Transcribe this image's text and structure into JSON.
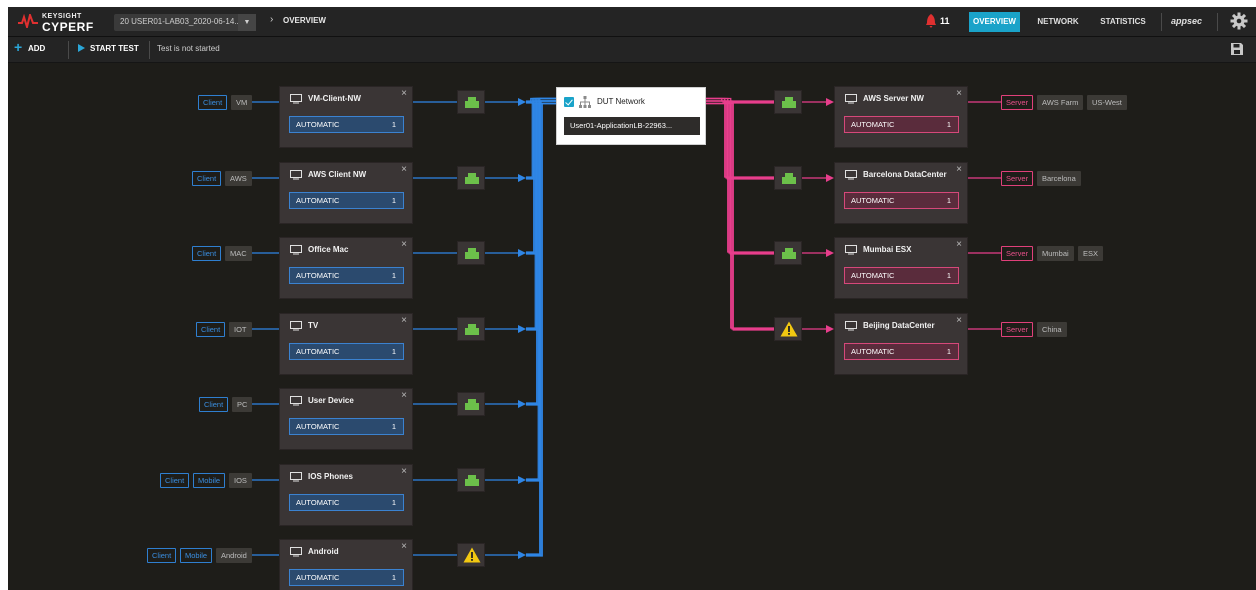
{
  "header": {
    "logo_small": "KEYSIGHT",
    "logo_big": "CYPERF",
    "config_name": "20 USER01-LAB03_2020-06-14...",
    "breadcrumb": "OVERVIEW",
    "alert_count": "11",
    "tabs": [
      {
        "label": "OVERVIEW",
        "active": true
      },
      {
        "label": "NETWORK",
        "active": false
      },
      {
        "label": "STATISTICS",
        "active": false
      }
    ],
    "user": "appsec"
  },
  "toolbar": {
    "add_label": "ADD",
    "start_label": "START TEST",
    "status": "Test is not started"
  },
  "client_networks": [
    {
      "tags": [
        {
          "text": "Client",
          "kind": "client"
        },
        {
          "text": "VM",
          "kind": "grey"
        }
      ],
      "name": "VM-Client-NW",
      "mode": "AUTOMATIC",
      "count": "1",
      "device": "switch"
    },
    {
      "tags": [
        {
          "text": "Client",
          "kind": "client"
        },
        {
          "text": "AWS",
          "kind": "grey"
        }
      ],
      "name": "AWS Client NW",
      "mode": "AUTOMATIC",
      "count": "1",
      "device": "switch"
    },
    {
      "tags": [
        {
          "text": "Client",
          "kind": "client"
        },
        {
          "text": "MAC",
          "kind": "grey"
        }
      ],
      "name": "Office Mac",
      "mode": "AUTOMATIC",
      "count": "1",
      "device": "switch"
    },
    {
      "tags": [
        {
          "text": "Client",
          "kind": "client"
        },
        {
          "text": "IOT",
          "kind": "grey"
        }
      ],
      "name": "TV",
      "mode": "AUTOMATIC",
      "count": "1",
      "device": "switch"
    },
    {
      "tags": [
        {
          "text": "Client",
          "kind": "client"
        },
        {
          "text": "PC",
          "kind": "grey"
        }
      ],
      "name": "User Device",
      "mode": "AUTOMATIC",
      "count": "1",
      "device": "switch"
    },
    {
      "tags": [
        {
          "text": "Client",
          "kind": "client"
        },
        {
          "text": "Mobile",
          "kind": "client"
        },
        {
          "text": "IOS",
          "kind": "grey"
        }
      ],
      "name": "IOS Phones",
      "mode": "AUTOMATIC",
      "count": "1",
      "device": "switch"
    },
    {
      "tags": [
        {
          "text": "Client",
          "kind": "client"
        },
        {
          "text": "Mobile",
          "kind": "client"
        },
        {
          "text": "Android",
          "kind": "grey"
        }
      ],
      "name": "Android",
      "mode": "AUTOMATIC",
      "count": "1",
      "device": "warning"
    }
  ],
  "dut": {
    "title": "DUT Network",
    "value": "User01-ApplicationLB-22963..."
  },
  "server_networks": [
    {
      "name": "AWS Server NW",
      "mode": "AUTOMATIC",
      "count": "1",
      "device": "switch",
      "tags": [
        {
          "text": "Server",
          "kind": "server"
        },
        {
          "text": "AWS Farm",
          "kind": "grey"
        },
        {
          "text": "US-West",
          "kind": "grey"
        }
      ]
    },
    {
      "name": "Barcelona DataCenter",
      "mode": "AUTOMATIC",
      "count": "1",
      "device": "switch",
      "tags": [
        {
          "text": "Server",
          "kind": "server"
        },
        {
          "text": "Barcelona",
          "kind": "grey"
        }
      ]
    },
    {
      "name": "Mumbai ESX",
      "mode": "AUTOMATIC",
      "count": "1",
      "device": "switch",
      "tags": [
        {
          "text": "Server",
          "kind": "server"
        },
        {
          "text": "Mumbai",
          "kind": "grey"
        },
        {
          "text": "ESX",
          "kind": "grey"
        }
      ]
    },
    {
      "name": "Beijing DataCenter",
      "mode": "AUTOMATIC",
      "count": "1",
      "device": "warning",
      "tags": [
        {
          "text": "Server",
          "kind": "server"
        },
        {
          "text": "China",
          "kind": "grey"
        }
      ]
    }
  ],
  "colors": {
    "client": "#2f86e6",
    "server": "#e83e8c",
    "accent": "#1aa3c9",
    "switch": "#6cc04a",
    "warning": "#f2c811",
    "alert": "#e03030"
  },
  "icons": {
    "node": "monitor-icon",
    "device": "network-switch-icon",
    "warning": "warning-icon",
    "dut": "network-tree-icon"
  }
}
